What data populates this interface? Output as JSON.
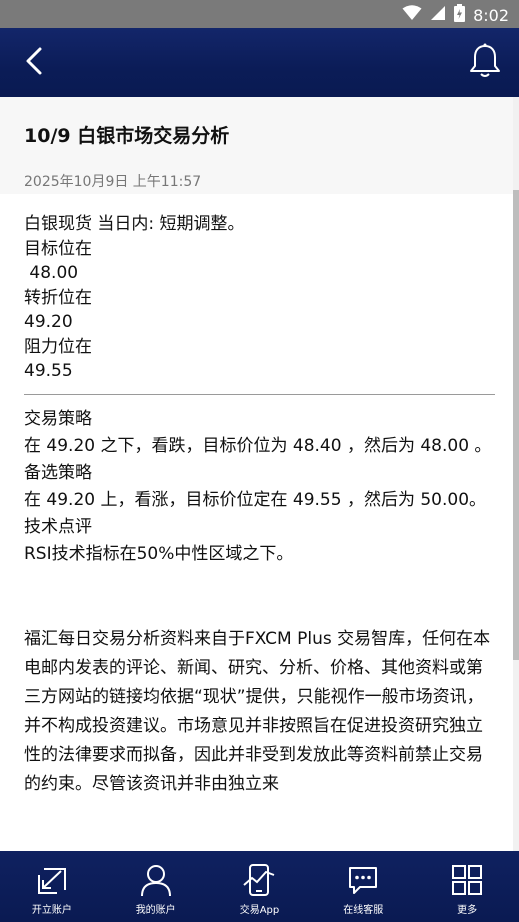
{
  "status_bar": {
    "time": "8:02",
    "icons": [
      "wifi-icon",
      "signal-icon",
      "battery-icon"
    ]
  },
  "header": {
    "back_icon": "chevron-left-icon",
    "bell_icon": "bell-icon",
    "background": "#0b1c57"
  },
  "article": {
    "title": "10/9 白银市场交易分析",
    "date": "2025年10月9日 上午11:57",
    "lines_top": [
      "白银现货 当日内: 短期调整。",
      "目标位在",
      " 48.00",
      "转折位在",
      "49.20",
      "阻力位在",
      "49.55"
    ],
    "lines_bottom": [
      "交易策略",
      "在 49.20 之下，看跌，目标价位为 48.40 ，然后为 48.00 。",
      "备选策略",
      "在 49.20 上，看涨，目标价位定在 49.55 ，然后为 50.00。",
      "技术点评",
      "RSI技术指标在50%中性区域之下。"
    ],
    "disclaimer": "福汇每日交易分析资料来自于FXCM Plus 交易智库，任何在本电邮内发表的评论、新闻、研究、分析、价格、其他资料或第三方网站的链接均依据“现状”提供，只能视作一般市场资讯，并不构成投资建议。市场意见并非按照旨在促进投资研究独立性的法律要求而拟备，因此并非受到发放此等资料前禁止交易的约束。尽管该资讯并非由独立来"
  },
  "bottom_nav": [
    {
      "label": "开立账户",
      "icon": "open-account-icon"
    },
    {
      "label": "我的账户",
      "icon": "user-icon"
    },
    {
      "label": "交易App",
      "icon": "trading-app-icon"
    },
    {
      "label": "在线客服",
      "icon": "chat-icon"
    },
    {
      "label": "更多",
      "icon": "grid-icon"
    }
  ]
}
